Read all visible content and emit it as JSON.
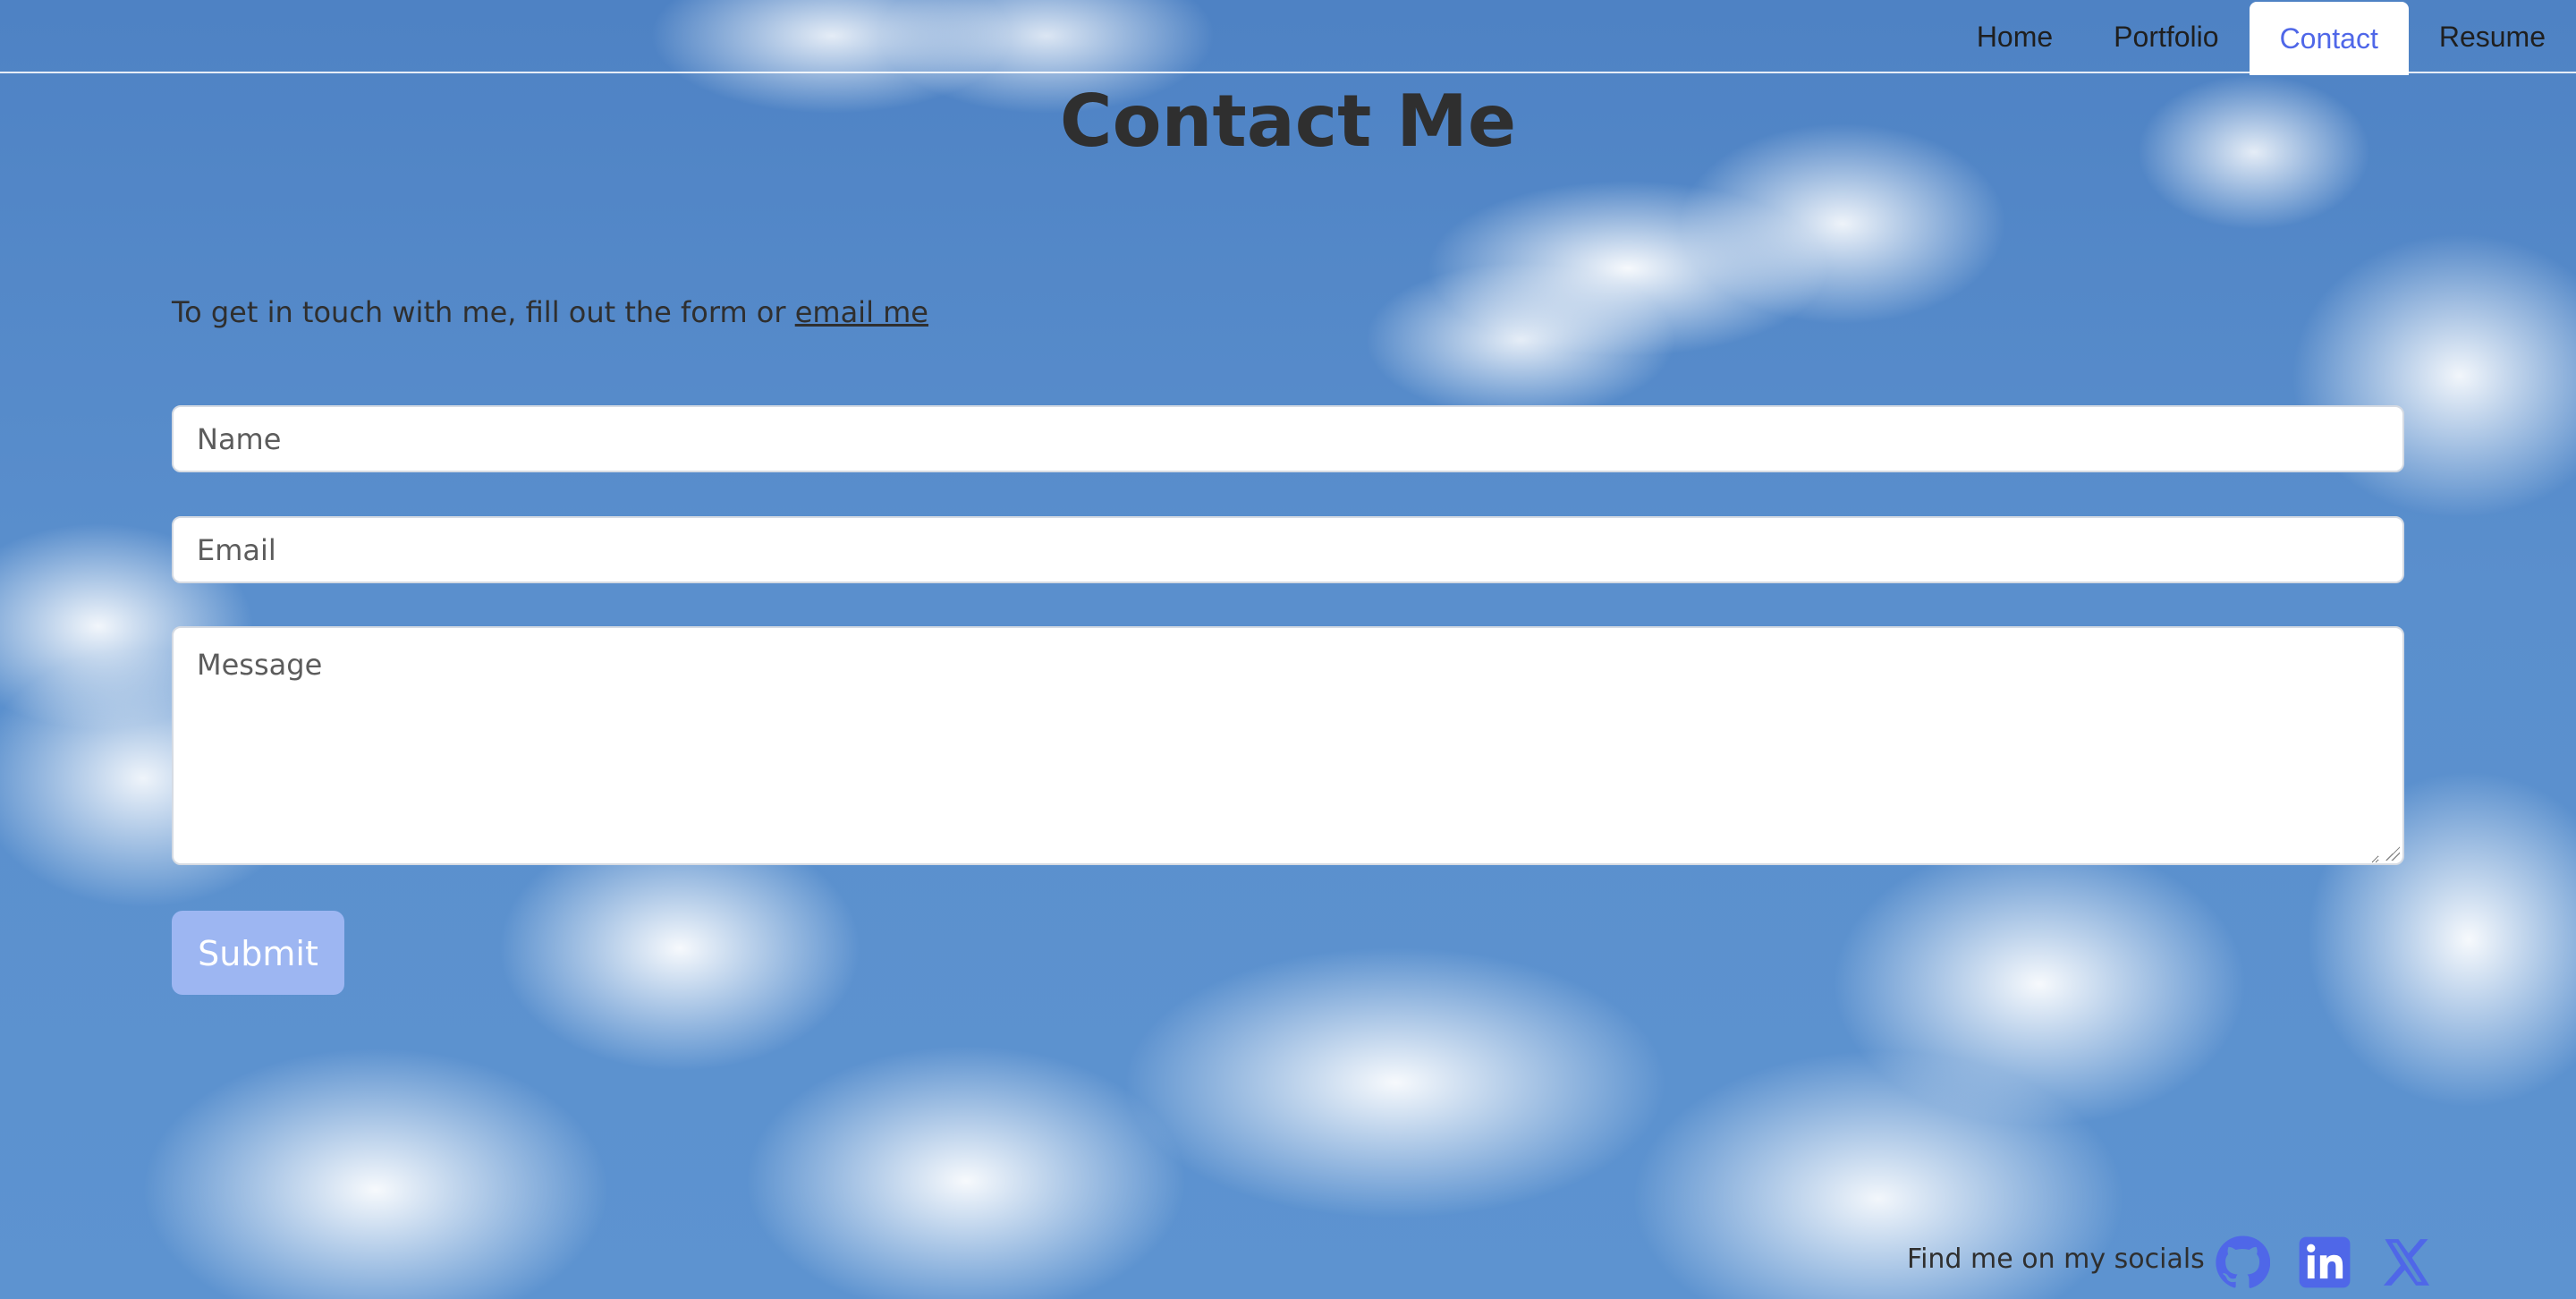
{
  "nav": {
    "items": [
      {
        "label": "Home",
        "active": false
      },
      {
        "label": "Portfolio",
        "active": false
      },
      {
        "label": "Contact",
        "active": true
      },
      {
        "label": "Resume",
        "active": false
      }
    ]
  },
  "page": {
    "title": "Contact Me",
    "intro_text": "To get in touch with me, fill out the form or ",
    "intro_link": "email me"
  },
  "form": {
    "name_placeholder": "Name",
    "email_placeholder": "Email",
    "message_placeholder": "Message",
    "submit_label": "Submit"
  },
  "footer": {
    "socials_label": "Find me on my socials",
    "icons": [
      "github-icon",
      "linkedin-icon",
      "x-icon"
    ]
  },
  "colors": {
    "accent": "#4f67e8",
    "submit_bg": "#9db6f2",
    "sky": "#5a8fcd"
  }
}
